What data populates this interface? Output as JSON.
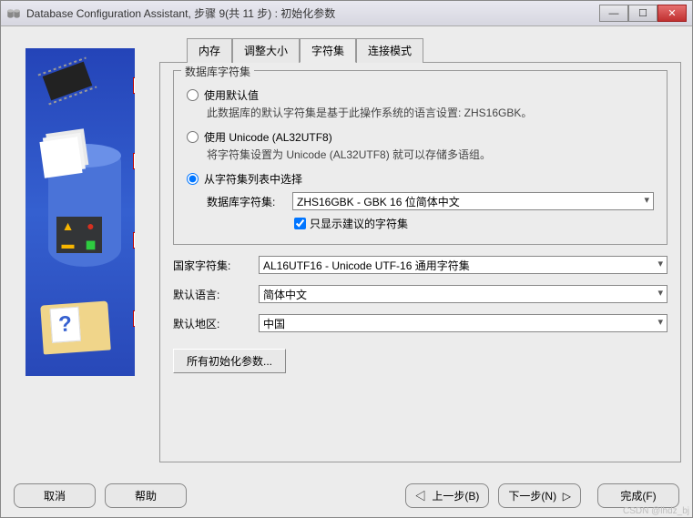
{
  "window": {
    "title": "Database Configuration Assistant, 步骤 9(共 11 步) : 初始化参数"
  },
  "tabs": {
    "items": [
      {
        "label": "内存",
        "active": false
      },
      {
        "label": "调整大小",
        "active": false
      },
      {
        "label": "字符集",
        "active": true
      },
      {
        "label": "连接模式",
        "active": false
      }
    ]
  },
  "charset_group": {
    "legend": "数据库字符集",
    "options": {
      "default": {
        "label": "使用默认值",
        "desc": "此数据库的默认字符集是基于此操作系统的语言设置: ZHS16GBK。",
        "selected": false
      },
      "unicode": {
        "label": "使用 Unicode (AL32UTF8)",
        "desc": "将字符集设置为 Unicode (AL32UTF8) 就可以存储多语组。",
        "selected": false
      },
      "from_list": {
        "label": "从字符集列表中选择",
        "selected": true,
        "db_charset_label": "数据库字符集:",
        "db_charset_value": "ZHS16GBK - GBK 16 位简体中文",
        "show_recommended_label": "只显示建议的字符集",
        "show_recommended_checked": true
      }
    }
  },
  "form": {
    "national_charset_label": "国家字符集:",
    "national_charset_value": "AL16UTF16 - Unicode UTF-16 通用字符集",
    "default_lang_label": "默认语言:",
    "default_lang_value": "简体中文",
    "default_region_label": "默认地区:",
    "default_region_value": "中国"
  },
  "buttons": {
    "all_params": "所有初始化参数...",
    "cancel": "取消",
    "help": "帮助",
    "back": "上一步(B)",
    "next": "下一步(N)",
    "finish": "完成(F)"
  },
  "watermark": "CSDN @lhdz_bj"
}
